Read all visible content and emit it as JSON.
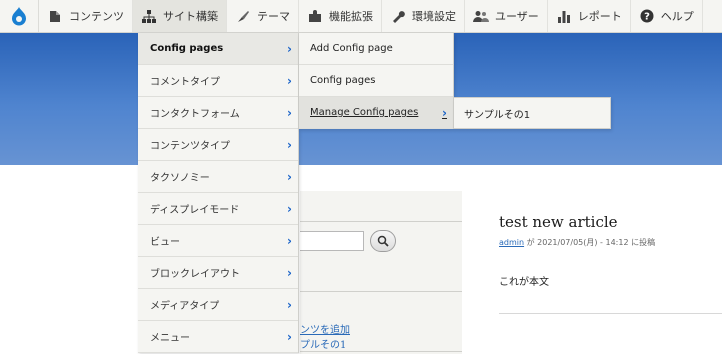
{
  "toolbar": {
    "items": [
      {
        "label": "コンテンツ",
        "icon": "document-icon"
      },
      {
        "label": "サイト構築",
        "icon": "sitemap-icon"
      },
      {
        "label": "テーマ",
        "icon": "brush-icon"
      },
      {
        "label": "機能拡張",
        "icon": "puzzle-icon"
      },
      {
        "label": "環境設定",
        "icon": "wrench-icon"
      },
      {
        "label": "ユーザー",
        "icon": "people-icon"
      },
      {
        "label": "レポート",
        "icon": "bar-chart-icon"
      },
      {
        "label": "ヘルプ",
        "icon": "question-icon"
      }
    ]
  },
  "menu_level1": [
    {
      "label": "Config pages"
    },
    {
      "label": "コメントタイプ"
    },
    {
      "label": "コンタクトフォーム"
    },
    {
      "label": "コンテンツタイプ"
    },
    {
      "label": "タクソノミー"
    },
    {
      "label": "ディスプレイモード"
    },
    {
      "label": "ビュー"
    },
    {
      "label": "ブロックレイアウト"
    },
    {
      "label": "メディアタイプ"
    },
    {
      "label": "メニュー"
    }
  ],
  "menu_level2": [
    {
      "label": "Add Config page"
    },
    {
      "label": "Config pages"
    },
    {
      "label": "Manage Config pages"
    }
  ],
  "menu_level3": [
    {
      "label": "サンプルその1"
    }
  ],
  "sidebar": {
    "link1": "ンツを追加",
    "link2": "プルその1"
  },
  "article": {
    "title": "test new article",
    "author": "admin",
    "meta_suffix": " が 2021/07/05(月) - 14:12 に投稿",
    "body": "これが本文"
  },
  "colors": {
    "header_blue": "#2a63b8",
    "link": "#2a6ab8",
    "arrow": "#1a63c8"
  }
}
